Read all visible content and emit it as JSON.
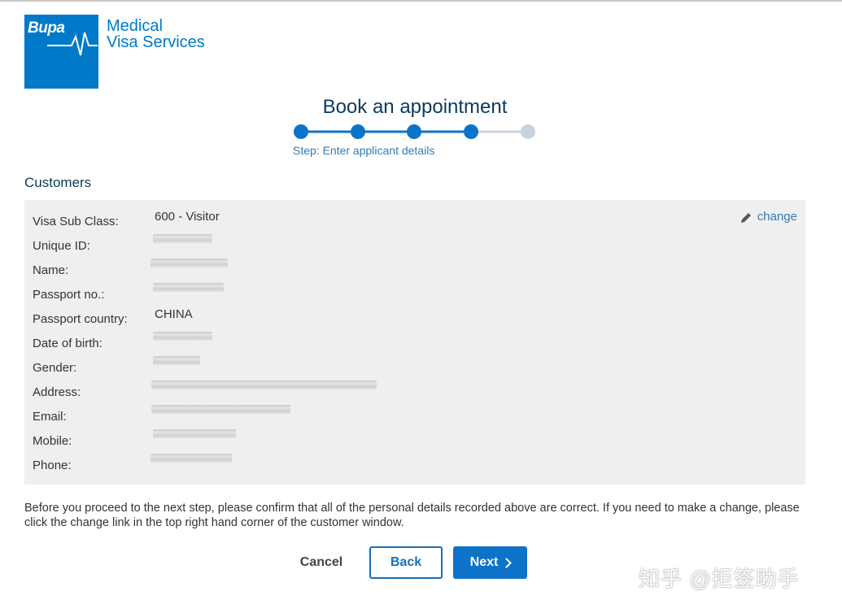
{
  "brand": {
    "logo_text": "Bupa",
    "name_line1": "Medical",
    "name_line2": "Visa Services",
    "color": "#0079c8"
  },
  "page": {
    "title": "Book an appointment",
    "step_caption": "Step: Enter applicant details",
    "steps_total": 5,
    "steps_completed": 4
  },
  "customers": {
    "heading": "Customers",
    "change_label": "change",
    "change_icon": "pencil-icon",
    "rows": [
      {
        "label": "Visa Sub Class:",
        "value": "600 - Visitor"
      },
      {
        "label": "Unique ID:",
        "value": ""
      },
      {
        "label": "Name:",
        "value": ""
      },
      {
        "label": "Passport no.:",
        "value": ""
      },
      {
        "label": "Passport country:",
        "value": "CHINA"
      },
      {
        "label": "Date of birth:",
        "value": ""
      },
      {
        "label": "Gender:",
        "value": ""
      },
      {
        "label": "Address:",
        "value": ""
      },
      {
        "label": "Email:",
        "value": ""
      },
      {
        "label": "Mobile:",
        "value": ""
      },
      {
        "label": "Phone:",
        "value": ""
      }
    ]
  },
  "notice": "Before you proceed to the next step, please confirm that all of the personal details recorded above are correct. If you need to make a change, please click the change link in the top right hand corner of the customer window.",
  "buttons": {
    "cancel": "Cancel",
    "back": "Back",
    "next": "Next"
  },
  "watermark": "知乎 @拒签助手",
  "colors": {
    "accent": "#0d73c8",
    "step_inactive": "#c8d3de",
    "panel_bg": "#efefef",
    "heading": "#0b3a5c"
  }
}
